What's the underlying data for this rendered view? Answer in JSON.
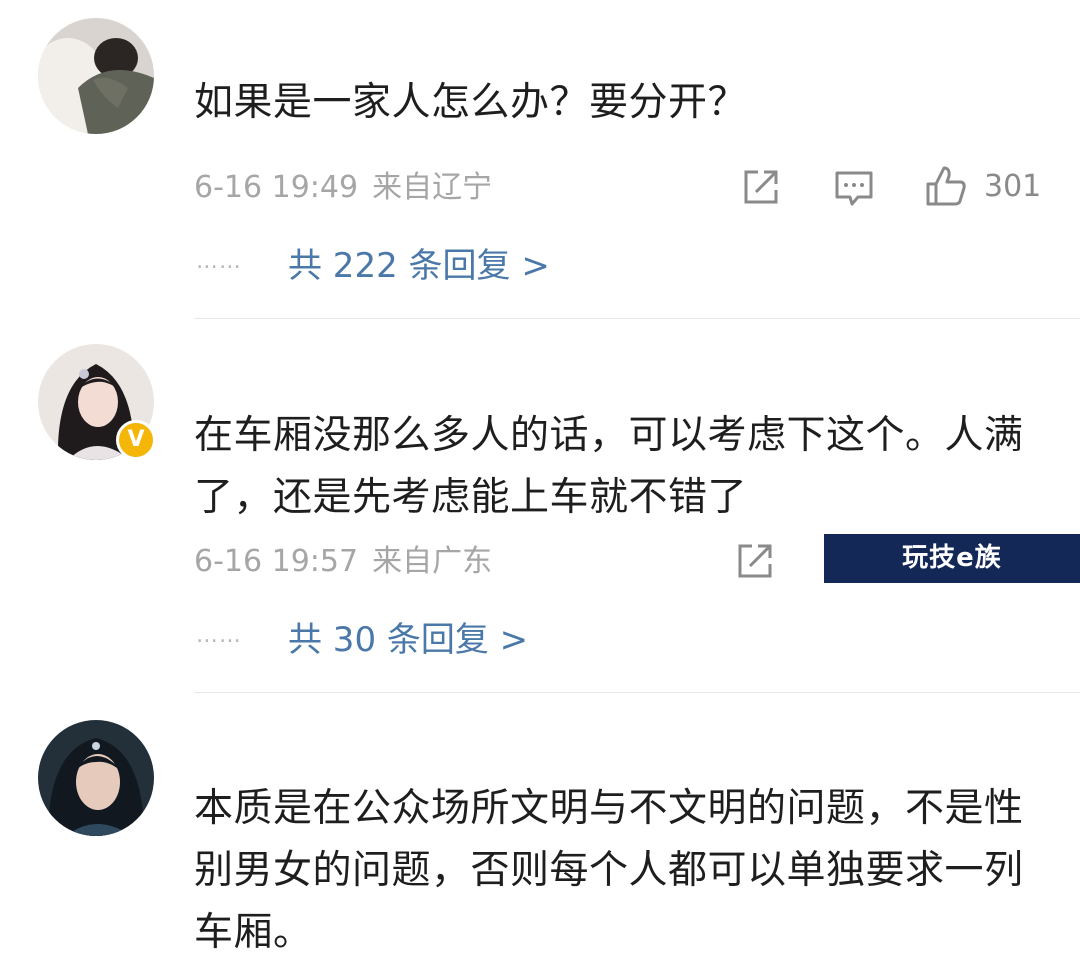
{
  "comments": [
    {
      "text": "如果是一家人怎么办？要分开？",
      "date": "6-16 19:49",
      "location": "来自辽宁",
      "likes": "301",
      "replies_label": "共 222 条回复 >",
      "dots": "⋯⋯"
    },
    {
      "text": "在车厢没那么多人的话，可以考虑下这个。人满了，还是先考虑能上车就不错了",
      "date": "6-16 19:57",
      "location": "来自广东",
      "replies_label": "共 30 条回复 >",
      "dots": "⋯⋯",
      "badge": "V"
    },
    {
      "text": "本质是在公众场所文明与不文明的问题，不是性别男女的问题，否则每个人都可以单独要求一列车厢。"
    }
  ],
  "watermark": "玩技e族",
  "icons": {
    "share": "share-icon",
    "comment": "comment-icon",
    "like": "thumbs-up-icon",
    "verified": "verified-badge-icon"
  },
  "colors": {
    "link": "#4a78a8",
    "meta": "#a6a6a6",
    "badge": "#f5b60a",
    "watermark_bg": "#142858"
  }
}
